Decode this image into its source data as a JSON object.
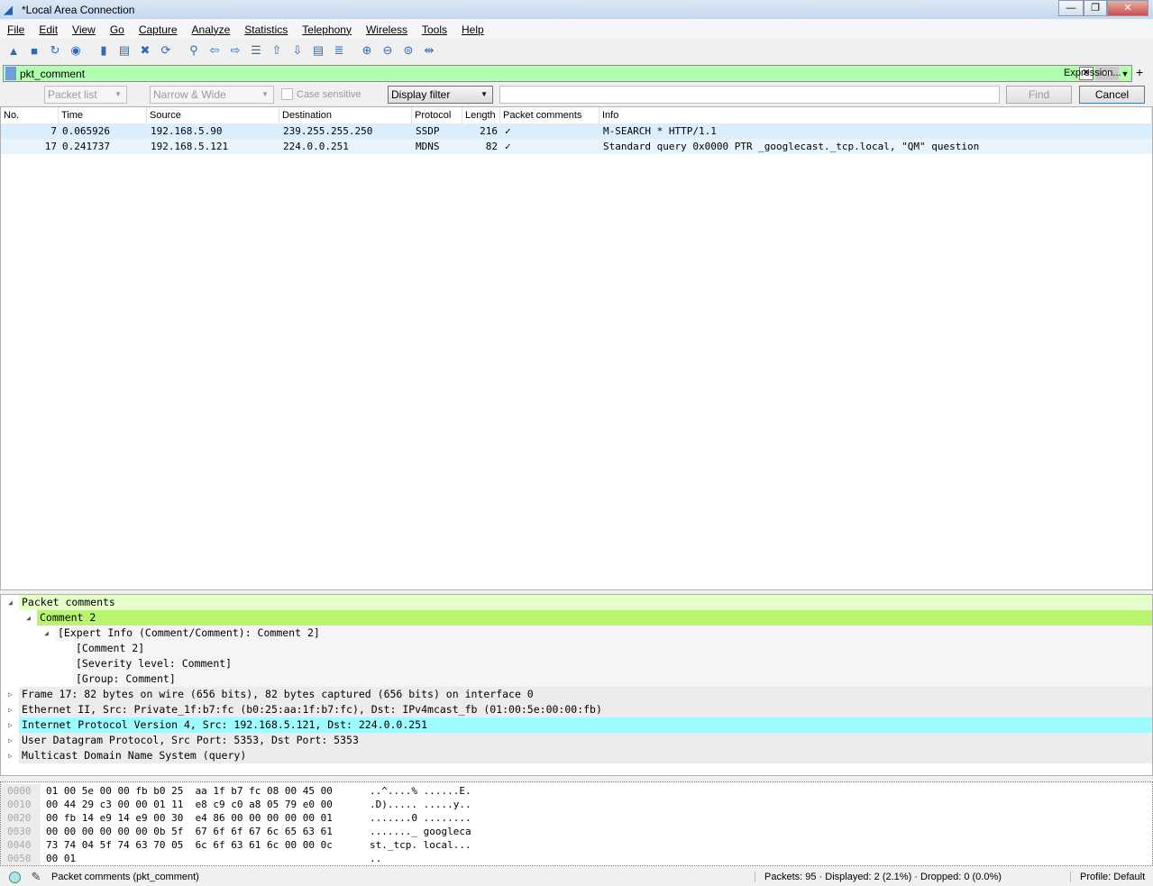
{
  "window": {
    "title": "*Local Area Connection",
    "controls": [
      "—",
      "❐",
      "✕"
    ]
  },
  "menu": [
    "File",
    "Edit",
    "View",
    "Go",
    "Capture",
    "Analyze",
    "Statistics",
    "Telephony",
    "Wireless",
    "Tools",
    "Help"
  ],
  "toolbar": [
    {
      "name": "start-capture-icon",
      "g": "▲"
    },
    {
      "name": "stop-capture-icon",
      "g": "■"
    },
    {
      "name": "restart-capture-icon",
      "g": "↻"
    },
    {
      "name": "capture-options-icon",
      "g": "◉"
    },
    {
      "name": "open-file-icon",
      "g": "▮"
    },
    {
      "name": "save-file-icon",
      "g": "▤"
    },
    {
      "name": "close-file-icon",
      "g": "✖"
    },
    {
      "name": "reload-file-icon",
      "g": "⟳"
    },
    {
      "name": "find-packet-icon",
      "g": "⚲"
    },
    {
      "name": "go-back-icon",
      "g": "⇦"
    },
    {
      "name": "go-forward-icon",
      "g": "⇨"
    },
    {
      "name": "go-to-packet-icon",
      "g": "☰"
    },
    {
      "name": "go-first-icon",
      "g": "⇧"
    },
    {
      "name": "go-last-icon",
      "g": "⇩"
    },
    {
      "name": "autoscroll-icon",
      "g": "▤"
    },
    {
      "name": "colorize-icon",
      "g": "≣"
    },
    {
      "name": "zoom-in-icon",
      "g": "⊕"
    },
    {
      "name": "zoom-out-icon",
      "g": "⊖"
    },
    {
      "name": "zoom-normal-icon",
      "g": "⊜"
    },
    {
      "name": "resize-columns-icon",
      "g": "⇹"
    }
  ],
  "filter": {
    "value": "pkt_comment",
    "expression_label": "Expression...",
    "add_label": "+"
  },
  "find": {
    "search_in": "Packet list",
    "char_width": "Narrow & Wide",
    "case_sensitive": "Case sensitive",
    "search_type": "Display filter",
    "query": "",
    "find_label": "Find",
    "cancel_label": "Cancel"
  },
  "columns": [
    "No.",
    "Time",
    "Source",
    "Destination",
    "Protocol",
    "Length",
    "Packet comments",
    "Info"
  ],
  "packets": [
    {
      "no": "7",
      "time": "0.065926",
      "src": "192.168.5.90",
      "dst": "239.255.255.250",
      "proto": "SSDP",
      "len": "216",
      "comment": "✓",
      "info": "M-SEARCH * HTTP/1.1"
    },
    {
      "no": "17",
      "time": "0.241737",
      "src": "192.168.5.121",
      "dst": "224.0.0.251",
      "proto": "MDNS",
      "len": "82",
      "comment": "✓",
      "info": "Standard query 0x0000 PTR _googlecast._tcp.local, \"QM\" question"
    }
  ],
  "details": [
    {
      "text": "Packet comments",
      "indent": 0,
      "state": "open",
      "bg": "#e4ffc7"
    },
    {
      "text": "Comment 2",
      "indent": 1,
      "state": "open",
      "bg": "#b8f56c"
    },
    {
      "text": "[Expert Info (Comment/Comment): Comment 2]",
      "indent": 2,
      "state": "open",
      "bg": "#f5f5f5"
    },
    {
      "text": "[Comment 2]",
      "indent": 3,
      "state": "",
      "bg": "#f5f5f5"
    },
    {
      "text": "[Severity level: Comment]",
      "indent": 3,
      "state": "",
      "bg": "#f5f5f5"
    },
    {
      "text": "[Group: Comment]",
      "indent": 3,
      "state": "",
      "bg": "#f5f5f5"
    },
    {
      "text": "Frame 17: 82 bytes on wire (656 bits), 82 bytes captured (656 bits) on interface 0",
      "indent": 0,
      "state": "closed",
      "bg": "#ececec"
    },
    {
      "text": "Ethernet II, Src: Private_1f:b7:fc (b0:25:aa:1f:b7:fc), Dst: IPv4mcast_fb (01:00:5e:00:00:fb)",
      "indent": 0,
      "state": "closed",
      "bg": "#ececec"
    },
    {
      "text": "Internet Protocol Version 4, Src: 192.168.5.121, Dst: 224.0.0.251",
      "indent": 0,
      "state": "closed",
      "bg": "#9ffbff"
    },
    {
      "text": "User Datagram Protocol, Src Port: 5353, Dst Port: 5353",
      "indent": 0,
      "state": "closed",
      "bg": "#ececec"
    },
    {
      "text": "Multicast Domain Name System (query)",
      "indent": 0,
      "state": "closed",
      "bg": "#ececec"
    }
  ],
  "hex": [
    {
      "off": "0000",
      "bytes": "01 00 5e 00 00 fb b0 25  aa 1f b7 fc 08 00 45 00",
      "ascii": "..^....% ......E."
    },
    {
      "off": "0010",
      "bytes": "00 44 29 c3 00 00 01 11  e8 c9 c0 a8 05 79 e0 00",
      "ascii": ".D)..... .....y.."
    },
    {
      "off": "0020",
      "bytes": "00 fb 14 e9 14 e9 00 30  e4 86 00 00 00 00 00 01",
      "ascii": ".......0 ........"
    },
    {
      "off": "0030",
      "bytes": "00 00 00 00 00 00 0b 5f  67 6f 6f 67 6c 65 63 61",
      "ascii": "......._ googleca"
    },
    {
      "off": "0040",
      "bytes": "73 74 04 5f 74 63 70 05  6c 6f 63 61 6c 00 00 0c",
      "ascii": "st._tcp. local..."
    },
    {
      "off": "0050",
      "bytes": "00 01",
      "ascii": ".."
    }
  ],
  "status": {
    "field": "Packet comments (pkt_comment)",
    "stats": "Packets: 95 · Displayed: 2 (2.1%) · Dropped: 0 (0.0%)",
    "profile": "Profile: Default"
  }
}
